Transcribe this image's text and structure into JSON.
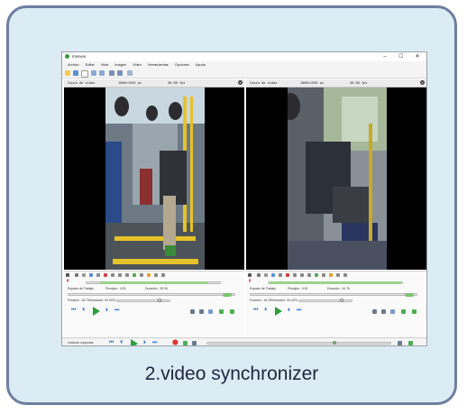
{
  "app": {
    "title": "Kinovea",
    "window_controls": {
      "minimize": "–",
      "maximize": "☐",
      "close": "✕"
    },
    "menu": [
      "Archivo",
      "Editar",
      "Vista",
      "Imagen",
      "Video",
      "Herramientas",
      "Opciones",
      "Ayuda"
    ]
  },
  "panes": [
    {
      "header": {
        "label": "Copia de video",
        "resolution": "1080×1920 px",
        "fps": "30.00 fps"
      },
      "workspace": {
        "label": "Espacio de Trabajo",
        "start": "Principio : 4.03",
        "duration": "Duración : 30.06"
      },
      "position": "Posición : 30.73",
      "speed": "Velocidad : 81.00%",
      "scene": "bus-front-seat"
    },
    {
      "header": {
        "label": "Copia de video",
        "resolution": "1080×1920 px",
        "fps": "30.00 fps"
      },
      "workspace": {
        "label": "Espacio de Trabajo",
        "start": "Principio : 0.00",
        "duration": "Duración : 44.76"
      },
      "position": "Posición : 44.29",
      "speed": "Velocidad : 81.00%",
      "scene": "bus-side-seat"
    }
  ],
  "sync": {
    "label": "Lecturas conjuntas"
  },
  "caption": "2.video synchronizer",
  "colors": {
    "accent": "#1f6fd0",
    "play": "#2aa03a",
    "range": "#9bd38a",
    "frame": "#6e7ea0",
    "card": "#dcecf4"
  }
}
